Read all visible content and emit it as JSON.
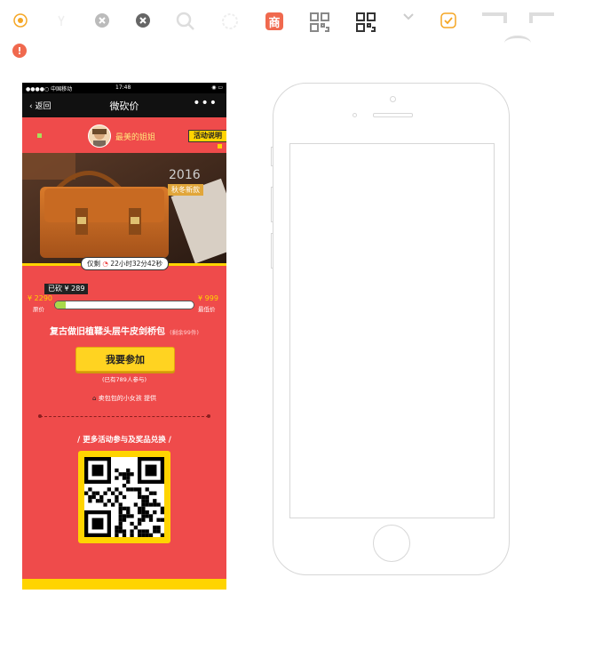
{
  "icons": [
    {
      "name": "radio-selected-icon",
      "color": "#f5a623"
    },
    {
      "name": "phone-icon",
      "color": "#eeeeee"
    },
    {
      "name": "clear-gray-icon",
      "color": "#bbbbbb"
    },
    {
      "name": "clear-dark-icon",
      "color": "#666666"
    },
    {
      "name": "search-icon",
      "color": "#dddddd"
    },
    {
      "name": "loading-icon",
      "color": "#eeeeee"
    },
    {
      "name": "shop-badge-icon",
      "color": "#f0694e",
      "label": "商"
    },
    {
      "name": "qrcode-gray-icon",
      "color": "#888888"
    },
    {
      "name": "qrcode-dark-icon",
      "color": "#333333"
    },
    {
      "name": "chevron-down-icon",
      "color": "#cccccc"
    },
    {
      "name": "checkbox-checked-icon",
      "color": "#f5a623"
    },
    {
      "name": "alert-icon",
      "color": "#f0694e",
      "label": "!"
    }
  ],
  "phone": {
    "status": {
      "carrier": "●●●●○ 中国移动",
      "time": "17:48",
      "battery": "◉ ▭"
    },
    "nav": {
      "back": "返回",
      "title": "微砍价",
      "more": "•••"
    },
    "user": {
      "name": "最美的姐姐",
      "rules_button": "活动说明"
    },
    "banner": {
      "year": "2016",
      "tag": "秋冬新款",
      "countdown_prefix": "仅剩",
      "countdown": "22小时32分42秒"
    },
    "price": {
      "cut_badge": "已砍 ¥ 289",
      "original_value": "¥ 2290",
      "original_label": "原价",
      "floor_value": "¥ 999",
      "floor_label": "最低价",
      "progress": 0.08
    },
    "product": {
      "title": "复古做旧植鞣头层牛皮剑桥包",
      "stock": "(剩余99件)"
    },
    "join": {
      "button": "我要参加",
      "participants": "(已有789人参与)"
    },
    "provider": {
      "name": "卖包包的小女孩",
      "suffix": "提供"
    },
    "promo": {
      "text": "/ 更多活动参与及奖品兑换 /"
    }
  },
  "colors": {
    "brand_red": "#ef4b4b",
    "accent_yellow": "#ffd400",
    "text_yellow": "#ffe27a"
  }
}
